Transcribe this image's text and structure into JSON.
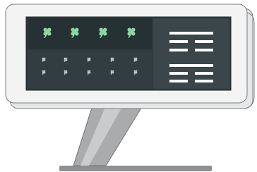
{
  "illustration": {
    "subject": "kiosk-display",
    "colors": {
      "frame": "#f3f3f3",
      "frame_edge": "#7a7d80",
      "screen_bg": "#2f3a3d",
      "left_panel_top": "#263133",
      "left_panel_bottom": "#313d40",
      "right_panel": "#3a4649",
      "accent_green": "#8dd9a4",
      "icon_grey": "#c8cfcf",
      "bar_white": "#ffffff",
      "stand": "#a6a8aa",
      "stand_dark": "#8c8f91",
      "base": "#8e9193"
    },
    "large_icons": [
      {
        "name": "clover-icon"
      },
      {
        "name": "clover-icon"
      },
      {
        "name": "clover-icon"
      },
      {
        "name": "clover-icon"
      }
    ],
    "small_icon_rows": 2,
    "small_icon_cols": 5,
    "hexagram_rows": [
      [
        "solid"
      ],
      [
        "broken"
      ],
      [
        "broken"
      ],
      [
        "solid"
      ],
      [
        "broken"
      ],
      [
        "broken"
      ]
    ]
  }
}
